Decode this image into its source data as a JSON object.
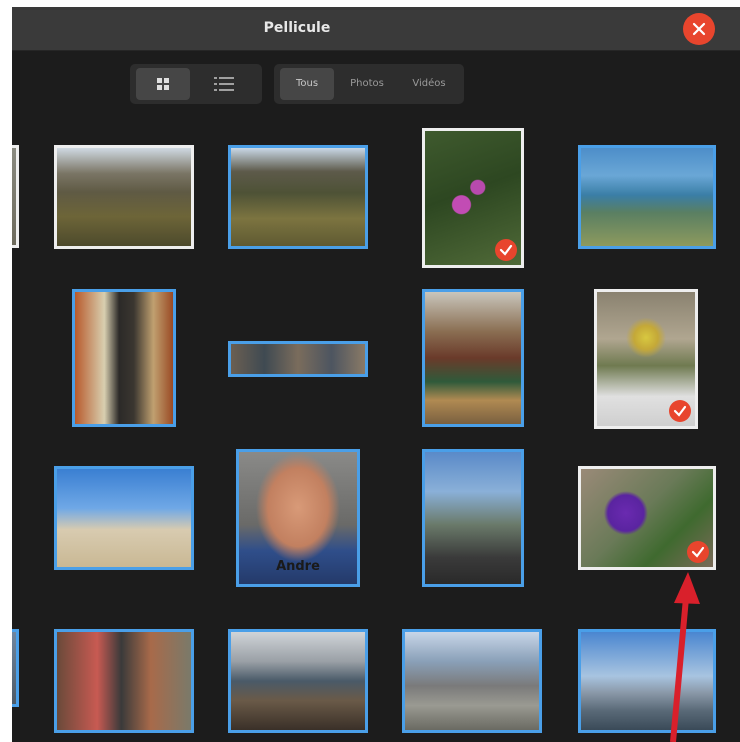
{
  "window": {
    "title": "Pellicule"
  },
  "toolbar": {
    "view_modes": [
      "grid-icon",
      "list-icon"
    ],
    "active_view": "grid",
    "filters": [
      {
        "label": "Tous",
        "active": true
      },
      {
        "label": "Photos",
        "active": false
      },
      {
        "label": "Vidéos",
        "active": false
      }
    ]
  },
  "photos": [
    {
      "scene": "garden lawn with house",
      "selected": false
    },
    {
      "scene": "lawn with picnic table",
      "selected": false
    },
    {
      "scene": "pink flowers on ivy",
      "selected": true
    },
    {
      "scene": "coastal cliff and sea",
      "selected": false
    },
    {
      "scene": "man in kitchen",
      "selected": false
    },
    {
      "scene": "group at dinner table (panorama)",
      "selected": false
    },
    {
      "scene": "man at desk in office",
      "selected": false
    },
    {
      "scene": "flower bouquet in vase",
      "selected": true
    },
    {
      "scene": "beach with sky and contrails",
      "selected": false
    },
    {
      "scene": "portrait of smiling man",
      "caption": "Andre",
      "selected": false
    },
    {
      "scene": "seaside promenade with people",
      "selected": false
    },
    {
      "scene": "purple flower",
      "selected": true
    },
    {
      "scene": "two men at event",
      "selected": false
    },
    {
      "scene": "rocky shore and sea",
      "selected": false
    },
    {
      "scene": "seaside boardwalk",
      "selected": false
    },
    {
      "scene": "harbour view with railings",
      "selected": false
    }
  ],
  "colors": {
    "background": "#1c1c1c",
    "titlebar": "#3a3a3a",
    "selection_border": "#4a9fe8",
    "checkmark_badge": "#e8452d",
    "annotation_arrow": "#d9202b"
  }
}
